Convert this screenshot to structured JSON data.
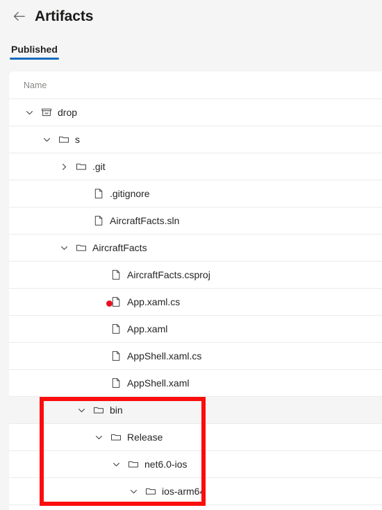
{
  "header": {
    "back_icon": "back-arrow-icon",
    "title": "Artifacts"
  },
  "tabs": [
    {
      "label": "Published",
      "active": true
    }
  ],
  "table": {
    "columns": [
      "Name"
    ]
  },
  "tree": {
    "rows": [
      {
        "label": "drop",
        "depth": 0,
        "icon": "archive-box-icon",
        "chevron": "expanded",
        "hovered": false
      },
      {
        "label": "s",
        "depth": 1,
        "icon": "folder-icon",
        "chevron": "expanded",
        "hovered": false
      },
      {
        "label": ".git",
        "depth": 2,
        "icon": "folder-icon",
        "chevron": "collapsed",
        "hovered": false
      },
      {
        "label": ".gitignore",
        "depth": 3,
        "icon": "file-icon",
        "chevron": "none",
        "hovered": false
      },
      {
        "label": "AircraftFacts.sln",
        "depth": 3,
        "icon": "file-icon",
        "chevron": "none",
        "hovered": false
      },
      {
        "label": "AircraftFacts",
        "depth": 2,
        "icon": "folder-icon",
        "chevron": "expanded",
        "hovered": false
      },
      {
        "label": "AircraftFacts.csproj",
        "depth": 4,
        "icon": "file-icon",
        "chevron": "none",
        "hovered": false
      },
      {
        "label": "App.xaml.cs",
        "depth": 4,
        "icon": "file-icon",
        "chevron": "none",
        "hovered": false
      },
      {
        "label": "App.xaml",
        "depth": 4,
        "icon": "file-icon",
        "chevron": "none",
        "hovered": false
      },
      {
        "label": "AppShell.xaml.cs",
        "depth": 4,
        "icon": "file-icon",
        "chevron": "none",
        "hovered": false
      },
      {
        "label": "AppShell.xaml",
        "depth": 4,
        "icon": "file-icon",
        "chevron": "none",
        "hovered": false
      },
      {
        "label": "bin",
        "depth": 3,
        "icon": "folder-icon",
        "chevron": "expanded",
        "hovered": true
      },
      {
        "label": "Release",
        "depth": 4,
        "icon": "folder-icon",
        "chevron": "expanded",
        "hovered": false
      },
      {
        "label": "net6.0-ios",
        "depth": 5,
        "icon": "folder-icon",
        "chevron": "expanded",
        "hovered": false
      },
      {
        "label": "ios-arm64",
        "depth": 6,
        "icon": "folder-icon",
        "chevron": "expanded",
        "hovered": false
      }
    ]
  },
  "annotations": {
    "highlight_box": {
      "color": "#fc0d0d",
      "covers": [
        "bin",
        "Release",
        "net6.0-ios",
        "ios-arm64"
      ]
    },
    "cursor_dot": {
      "color": "#e81123",
      "over": "App.xaml.cs"
    }
  },
  "colors": {
    "accent": "#0f6cbd",
    "page_background": "#f5f5f5",
    "panel_background": "#ffffff",
    "row_divider": "#ebebeb",
    "row_hover": "#f5f5f5",
    "text_primary": "#242424",
    "text_secondary": "#8a8886"
  }
}
